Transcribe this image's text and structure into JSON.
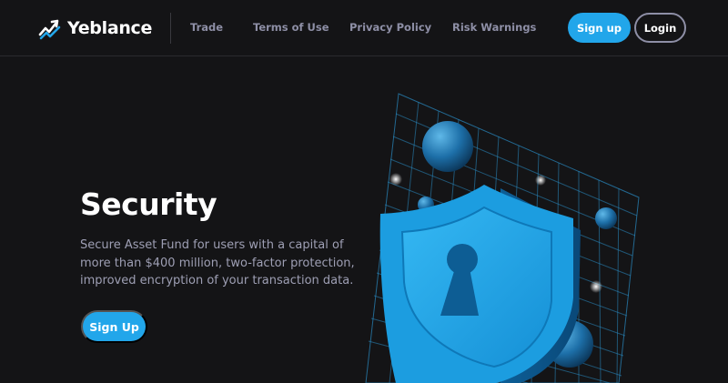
{
  "brand": {
    "name": "Yeblance",
    "logo_icon": "chart-growth-icon",
    "accent": "#22a6ea"
  },
  "nav": {
    "items": [
      {
        "label": "Trade"
      },
      {
        "label": "Terms of Use"
      },
      {
        "label": "Privacy Policy"
      },
      {
        "label": "Risk Warnings"
      }
    ],
    "signup_label": "Sign up",
    "login_label": "Login"
  },
  "hero": {
    "title": "Security",
    "description": "Secure Asset Fund for users with a capital of more than $400 million, two-factor protection, improved encryption of your transaction data.",
    "cta_label": "Sign Up",
    "illustration_icon": "shield-keyhole-icon"
  },
  "colors": {
    "background": "#141416",
    "accent": "#22a6ea",
    "muted_text": "#9e9fb4",
    "nav_text": "#8e8fa6"
  }
}
